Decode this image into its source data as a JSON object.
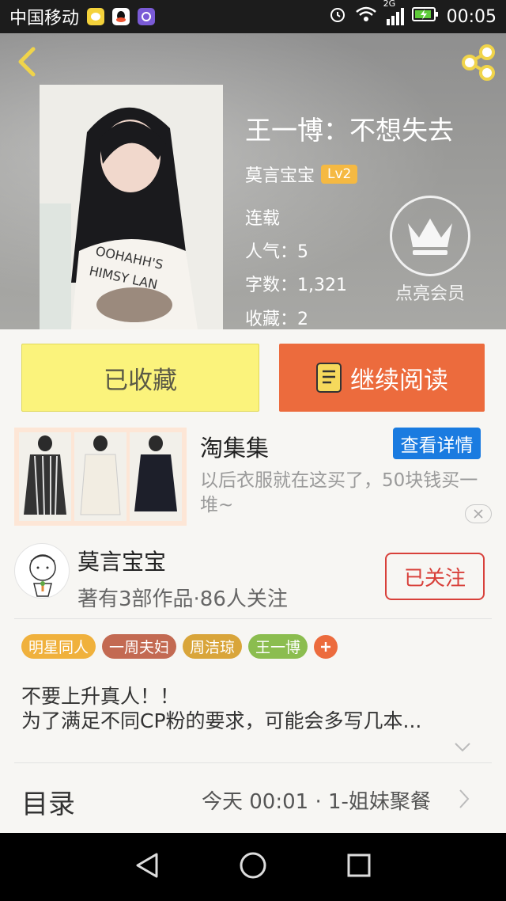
{
  "status_bar": {
    "carrier": "中国移动",
    "network": "2G",
    "time": "00:05"
  },
  "book": {
    "title": "王一博：不想失去",
    "author": "莫言宝宝",
    "level": "Lv2",
    "status": "连载",
    "popularity": "人气：5",
    "word_count": "字数：1,321",
    "favorites": "收藏：2"
  },
  "vip": {
    "label": "点亮会员"
  },
  "actions": {
    "favorited_label": "已收藏",
    "continue_label": "继续阅读"
  },
  "ad": {
    "title": "淘集集",
    "detail_label": "查看详情",
    "description": "以后衣服就在这买了，50块钱买一堆~"
  },
  "author_panel": {
    "name": "莫言宝宝",
    "stats": "著有3部作品·86人关注",
    "follow_label": "已关注"
  },
  "tags": [
    {
      "label": "明星同人",
      "color": "#f0b13c"
    },
    {
      "label": "一周夫妇",
      "color": "#c36a52"
    },
    {
      "label": "周洁琼",
      "color": "#d9a53a"
    },
    {
      "label": "王一博",
      "color": "#8bbd4f"
    }
  ],
  "intro": {
    "line1": "不要上升真人！！",
    "line2": "为了满足不同CP粉的要求，可能会多写几本..."
  },
  "toc": {
    "label": "目录",
    "latest": "今天 00:01 · 1-姐妹聚餐"
  },
  "colors": {
    "accent_orange": "#ec6b3d",
    "favorite_yellow": "#fbf37c",
    "ad_blue": "#1a7be0",
    "follow_red": "#d8403a"
  }
}
